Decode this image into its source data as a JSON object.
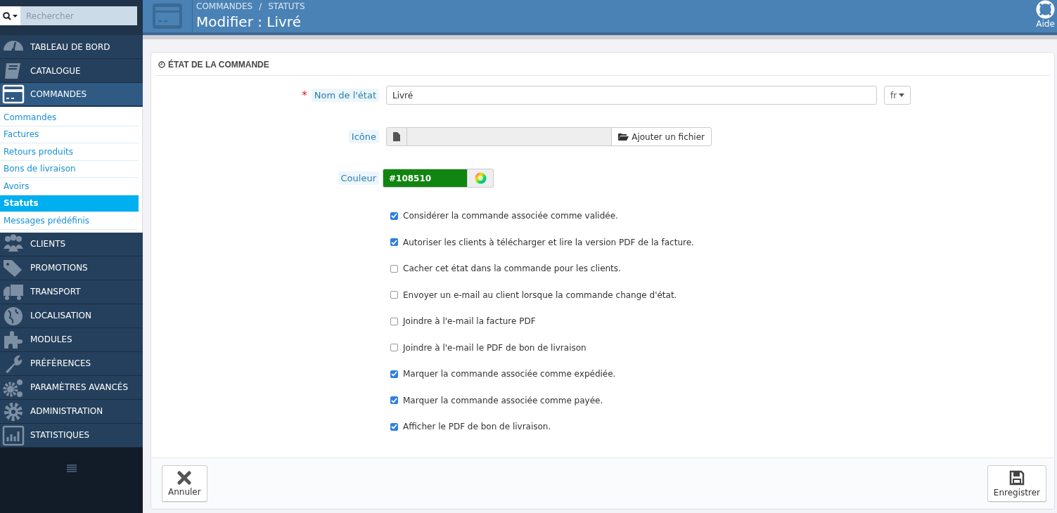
{
  "search": {
    "placeholder": "Rechercher"
  },
  "sidebar": {
    "items": [
      {
        "label": "TABLEAU DE BORD",
        "selected": false
      },
      {
        "label": "CATALOGUE",
        "selected": false
      },
      {
        "label": "COMMANDES",
        "selected": true,
        "expanded": true,
        "children": [
          {
            "label": "Commandes",
            "selected": false
          },
          {
            "label": "Factures",
            "selected": false
          },
          {
            "label": "Retours produits",
            "selected": false
          },
          {
            "label": "Bons de livraison",
            "selected": false
          },
          {
            "label": "Avoirs",
            "selected": false
          },
          {
            "label": "Statuts",
            "selected": true
          },
          {
            "label": "Messages prédéfinis",
            "selected": false
          }
        ]
      },
      {
        "label": "CLIENTS",
        "selected": false
      },
      {
        "label": "PROMOTIONS",
        "selected": false
      },
      {
        "label": "TRANSPORT",
        "selected": false
      },
      {
        "label": "LOCALISATION",
        "selected": false
      },
      {
        "label": "MODULES",
        "selected": false
      },
      {
        "label": "PRÉFÉRENCES",
        "selected": false
      },
      {
        "label": "PARAMÈTRES AVANCÉS",
        "selected": false
      },
      {
        "label": "ADMINISTRATION",
        "selected": false
      },
      {
        "label": "STATISTIQUES",
        "selected": false
      }
    ]
  },
  "header": {
    "breadcrumb": [
      "COMMANDES",
      "STATUTS"
    ],
    "separator": "/",
    "title": "Modifier : Livré",
    "help": "Aide"
  },
  "panel": {
    "title": "ÉTAT DE LA COMMANDE",
    "fields": [
      {
        "kind": "text",
        "label": "Nom de l'état",
        "required_mark": "*",
        "value": "Livré",
        "language": "fr"
      },
      {
        "kind": "file",
        "label": "Icône",
        "button": "Ajouter un fichier"
      },
      {
        "kind": "color",
        "label": "Couleur",
        "value": "#108510"
      }
    ],
    "checkboxes": [
      {
        "label": "Considérer la commande associée comme validée.",
        "checked": true
      },
      {
        "label": "Autoriser les clients à télécharger et lire la version PDF de la facture.",
        "checked": true
      },
      {
        "label": "Cacher cet état dans la commande pour les clients.",
        "checked": false
      },
      {
        "label": "Envoyer un e-mail au client lorsque la commande change d'état.",
        "checked": false
      },
      {
        "label": "Joindre à l'e-mail la facture PDF",
        "checked": false
      },
      {
        "label": "Joindre à l'e-mail le PDF de bon de livraison",
        "checked": false
      },
      {
        "label": "Marquer la commande associée comme expédiée.",
        "checked": true
      },
      {
        "label": "Marquer la commande associée comme payée.",
        "checked": true
      },
      {
        "label": "Afficher le PDF de bon de livraison.",
        "checked": true
      }
    ],
    "footer": {
      "cancel": "Annuler",
      "save": "Enregistrer"
    }
  }
}
